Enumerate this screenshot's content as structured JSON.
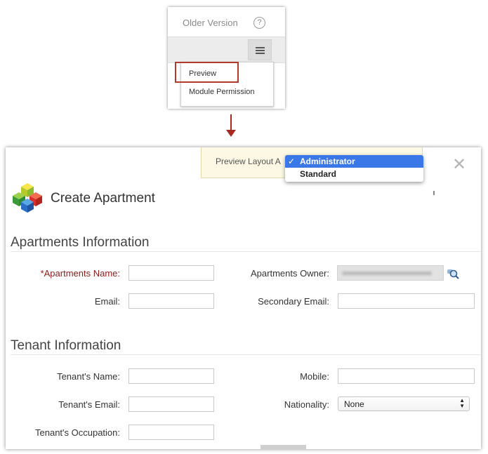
{
  "menu": {
    "older_version": "Older Version",
    "help_glyph": "?",
    "items": [
      "Preview",
      "Module Permission"
    ]
  },
  "preview_bar": {
    "text": "Preview Layout A"
  },
  "layout_roles": {
    "selected_mark": "✓",
    "options": [
      "Administrator",
      "Standard"
    ],
    "selected": "Administrator"
  },
  "page": {
    "title": "Create Apartment"
  },
  "sections": [
    {
      "title": "Apartments Information",
      "fields": {
        "name": {
          "required_mark": "*",
          "label": "Apartments Name:"
        },
        "owner": {
          "label": "Apartments Owner:"
        },
        "email": {
          "label": "Email:"
        },
        "secondary_email": {
          "label": "Secondary Email:"
        }
      }
    },
    {
      "title": "Tenant Information",
      "fields": {
        "name": {
          "label": "Tenant's Name:"
        },
        "mobile": {
          "label": "Mobile:"
        },
        "email": {
          "label": "Tenant's Email:"
        },
        "nationality": {
          "label": "Nationality:",
          "value": "None"
        },
        "occupation": {
          "label": "Tenant's Occupation:"
        }
      }
    }
  ],
  "colors": {
    "highlight_border": "#b23a2a",
    "arrow": "#a52a1f",
    "selected_option_bg": "#3b78e7",
    "required_label": "#8b1a1a",
    "preview_bar_bg": "#fcf8e3"
  },
  "icons": [
    "help-icon",
    "menu-icon",
    "down-arrow-icon",
    "close-icon",
    "module-logo-icon",
    "lookup-icon",
    "select-arrows-icon",
    "checkmark-icon"
  ]
}
